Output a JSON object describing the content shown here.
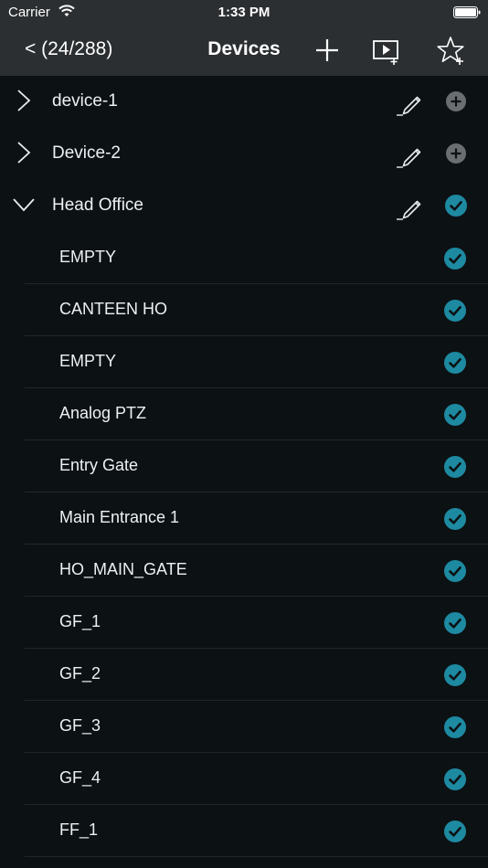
{
  "status_bar": {
    "carrier": "Carrier",
    "time": "1:33 PM"
  },
  "nav": {
    "back_label": "< (24/288)",
    "title": "Devices"
  },
  "icons": {
    "add": "plus-icon",
    "add_video": "video-add-icon",
    "add_favorite": "star-add-icon",
    "edit": "pencil-icon",
    "expand_collapsed": "chevron-right-icon",
    "expand_open": "chevron-down-icon",
    "unchecked": "add-circle-icon",
    "checked": "check-circle-icon"
  },
  "colors": {
    "bar_bg": "#2b2f32",
    "list_bg": "#0c1114",
    "checked": "#1d8aa1",
    "unchecked": "#6a6e70"
  },
  "groups": [
    {
      "name": "device-1",
      "expanded": false,
      "checked": false
    },
    {
      "name": "Device-2",
      "expanded": false,
      "checked": false
    },
    {
      "name": "Head Office",
      "expanded": true,
      "checked": true
    }
  ],
  "channels": [
    {
      "name": "EMPTY",
      "checked": true
    },
    {
      "name": "CANTEEN HO",
      "checked": true
    },
    {
      "name": "EMPTY",
      "checked": true
    },
    {
      "name": "Analog PTZ",
      "checked": true
    },
    {
      "name": "Entry Gate",
      "checked": true
    },
    {
      "name": "Main Entrance 1",
      "checked": true
    },
    {
      "name": "HO_MAIN_GATE",
      "checked": true
    },
    {
      "name": "GF_1",
      "checked": true
    },
    {
      "name": "GF_2",
      "checked": true
    },
    {
      "name": "GF_3",
      "checked": true
    },
    {
      "name": "GF_4",
      "checked": true
    },
    {
      "name": "FF_1",
      "checked": true
    }
  ]
}
